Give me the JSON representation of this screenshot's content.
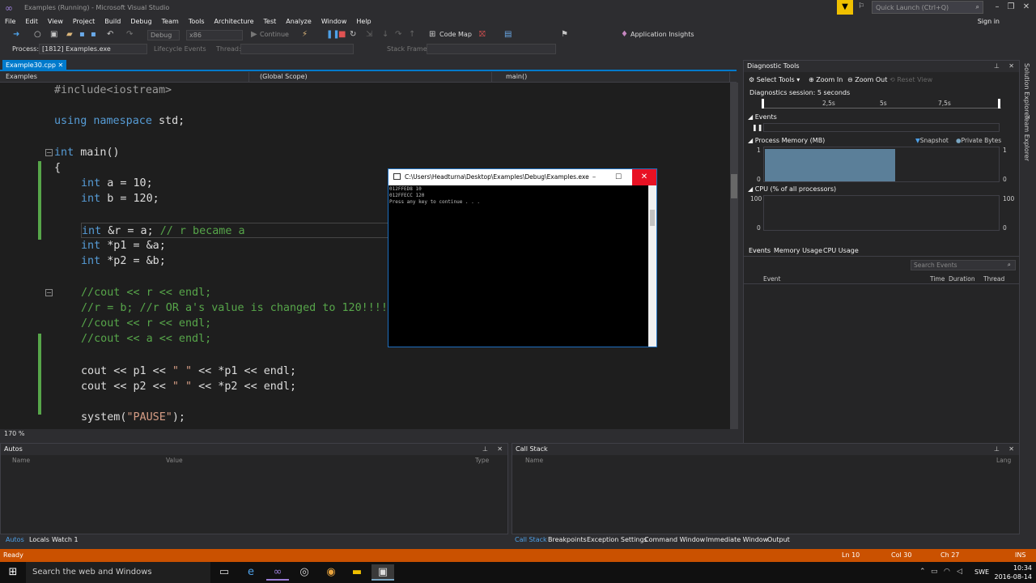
{
  "window": {
    "title": "Examples (Running) - Microsoft Visual Studio",
    "quick_launch": "Quick Launch (Ctrl+Q)",
    "sign_in": "Sign in"
  },
  "menu": [
    "File",
    "Edit",
    "View",
    "Project",
    "Build",
    "Debug",
    "Team",
    "Tools",
    "Architecture",
    "Test",
    "Analyze",
    "Window",
    "Help"
  ],
  "toolbar": {
    "config": "Debug",
    "platform": "x86",
    "continue": "Continue",
    "code_map": "Code Map",
    "app_insights": "Application Insights",
    "process_label": "Process:",
    "process": "[1812] Examples.exe",
    "lifecycle": "Lifecycle Events",
    "thread_label": "Thread:",
    "stack_frame": "Stack Frame:"
  },
  "editor": {
    "tab": "Example30.cpp",
    "nav_project": "Examples",
    "nav_scope": "(Global Scope)",
    "nav_function": "main()",
    "zoom": "170 %",
    "code": {
      "l1": "#include<iostream>",
      "l2a": "using",
      "l2b": "namespace",
      "l2c": " std;",
      "l3a": "int",
      "l3b": " main()",
      "l4": "{",
      "l5a": "int",
      "l5b": " a = 10;",
      "l6a": "int",
      "l6b": " b = 120;",
      "l7a": "int",
      "l7b": " &r = a; ",
      "l7c": "// r became a",
      "l8a": "int",
      "l8b": " *p1 = &a;",
      "l9a": "int",
      "l9b": " *p2 = &b;",
      "l10": "//cout << r << endl;",
      "l11": "//r = b; //r OR a's value is changed to 120!!!!",
      "l12": "//cout << r << endl;",
      "l13": "//cout << a << endl;",
      "l14a": "cout << p1 << ",
      "l14b": "\" \"",
      "l14c": " << *p1 << endl;",
      "l15a": "cout << p2 << ",
      "l15b": "\" \"",
      "l15c": " << *p2 << endl;",
      "l16a": "system(",
      "l16b": "\"PAUSE\"",
      "l16c": ");"
    }
  },
  "console": {
    "title": "C:\\Users\\Headturna\\Desktop\\Examples\\Debug\\Examples.exe",
    "lines": [
      "012FFED8 10",
      "012FFECC 120",
      "Press any key to continue . . ."
    ]
  },
  "diagnostics": {
    "title": "Diagnostic Tools",
    "select_tools": "Select Tools",
    "zoom_in": "Zoom In",
    "zoom_out": "Zoom Out",
    "reset_view": "Reset View",
    "session": "Diagnostics session: 5 seconds",
    "ticks": [
      "2,5s",
      "5s",
      "7,5s"
    ],
    "events_label": "Events",
    "memory_label": "Process Memory (MB)",
    "snapshot": "Snapshot",
    "private_bytes": "Private Bytes",
    "memory_axis": {
      "max": "1",
      "min": "0"
    },
    "cpu_label": "CPU (% of all processors)",
    "cpu_axis": {
      "max": "100",
      "min": "0"
    },
    "tabs": [
      "Events",
      "Memory Usage",
      "CPU Usage"
    ],
    "search": "Search Events",
    "columns": [
      "Event",
      "Time",
      "Duration",
      "Thread"
    ],
    "memory_fill_fraction": 0.56
  },
  "side_tabs": [
    "Solution Explorer",
    "Team Explorer"
  ],
  "autos": {
    "title": "Autos",
    "columns": [
      "Name",
      "Value",
      "Type"
    ],
    "tabs": [
      "Autos",
      "Locals",
      "Watch 1"
    ]
  },
  "callstack": {
    "title": "Call Stack",
    "columns": [
      "Name",
      "Lang"
    ],
    "tabs": [
      "Call Stack",
      "Breakpoints",
      "Exception Settings",
      "Command Window",
      "Immediate Window",
      "Output"
    ]
  },
  "status": {
    "state": "Ready",
    "line": "Ln 10",
    "col": "Col 30",
    "ch": "Ch 27",
    "mode": "INS"
  },
  "taskbar": {
    "search": "Search the web and Windows",
    "time": "10:34",
    "date": "2016-08-14",
    "lang": "SWE"
  },
  "colors": {
    "accent": "#007acc",
    "status": "#ca5100",
    "keyword": "#569cd6",
    "comment": "#57a64a",
    "string": "#d69d85"
  }
}
